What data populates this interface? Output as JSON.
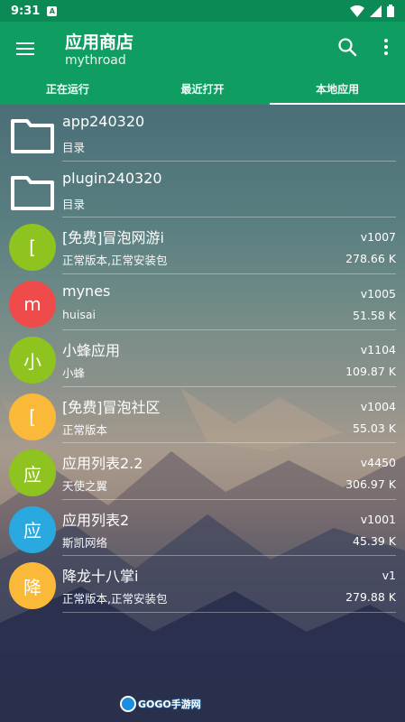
{
  "status": {
    "time": "9:31",
    "notif": "A"
  },
  "appbar": {
    "title": "应用商店",
    "subtitle": "mythroad"
  },
  "tabs": [
    {
      "label": "正在运行"
    },
    {
      "label": "最近打开"
    },
    {
      "label": "本地应用"
    }
  ],
  "items": [
    {
      "name": "app240320",
      "desc": "目录",
      "type": "folder"
    },
    {
      "name": "plugin240320",
      "desc": "目录",
      "type": "folder"
    },
    {
      "name": "[免费]冒泡网游i",
      "desc": "正常版本,正常安装包",
      "version": "v1007",
      "size": "278.66 K",
      "avatar": "[",
      "color": "#8fc31f"
    },
    {
      "name": "mynes",
      "desc": "huisai",
      "version": "v1005",
      "size": "51.58 K",
      "avatar": "m",
      "color": "#ef4b4b"
    },
    {
      "name": "小蜂应用",
      "desc": "小蜂",
      "version": "v1104",
      "size": "109.87 K",
      "avatar": "小",
      "color": "#8fc31f"
    },
    {
      "name": "[免费]冒泡社区",
      "desc": "正常版本",
      "version": "v1004",
      "size": "55.03 K",
      "avatar": "[",
      "color": "#fbb93a"
    },
    {
      "name": "应用列表2.2",
      "desc": "天使之翼",
      "version": "v4450",
      "size": "306.97 K",
      "avatar": "应",
      "color": "#8fc31f"
    },
    {
      "name": "应用列表2",
      "desc": "斯凯网络",
      "version": "v1001",
      "size": "45.39 K",
      "avatar": "应",
      "color": "#29a9e0"
    },
    {
      "name": "降龙十八掌i",
      "desc": "正常版本,正常安装包",
      "version": "v1",
      "size": "279.88 K",
      "avatar": "降",
      "color": "#fbb93a"
    }
  ],
  "watermark": {
    "text": "GOGO手游网"
  },
  "colors": {
    "appbar": "#0f9d62",
    "statusbar": "#0b8a55"
  }
}
